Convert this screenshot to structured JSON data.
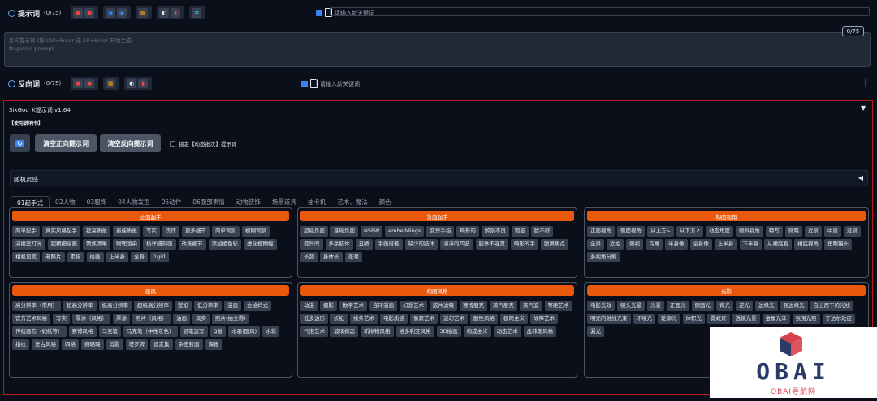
{
  "prompt": {
    "title": "提示词",
    "count": "(0/75)",
    "kw_placeholder": "请输入新关键词"
  },
  "negative": {
    "hint": "反向提示词 (按 Ctrl+Enter 或 Alt+Enter 开始生成)",
    "placeholder": "Negative prompt",
    "badge": "0/75",
    "title": "反向词",
    "count": "(0/75)",
    "kw_placeholder": "请输入新关键词"
  },
  "panel": {
    "title": "SixGod_K提示词 v1.64",
    "note": "【使用说明书】",
    "btn_clear_pos": "清空正向提示词",
    "btn_clear_neg": "清空反向提示词",
    "lock_label": "锁定【动态批次】提示词",
    "random": "随机灵感",
    "collapse": "▼",
    "expand": "◀"
  },
  "tabs": [
    "01起手式",
    "02人物",
    "03服饰",
    "04人物发型",
    "05动作",
    "06面部表情",
    "动物装饰",
    "场景道具",
    "抽卡机",
    "艺术、魔法",
    "颜色"
  ],
  "cards": [
    {
      "title": "正面起手",
      "tags": [
        "简单起手",
        "真实风格起手",
        "提高质量",
        "最佳质量",
        "写实",
        "杰作",
        "更多细节",
        "简单背景",
        "模糊背景",
        "演播室灯光",
        "超精细绘画",
        "聚焦清晰",
        "物理渲染",
        "极详细刻画",
        "改善细节",
        "添加绝色彩",
        "虚化模糊幅",
        "相机设置",
        "老照片",
        "素描",
        "绘画",
        "上半身",
        "全身",
        "1girl"
      ]
    },
    {
      "title": "负面起手",
      "tags": [
        "超级负面",
        "基础负面",
        "NSFW",
        "embeddings",
        "变异手指",
        "畸形的",
        "解剖不良",
        "瑕疵",
        "脸不好",
        "变异的",
        "多余肢体",
        "丑陋",
        "手画得差",
        "缺少的肢体",
        "漂浮的四肢",
        "肢体不连贯",
        "畸形的手",
        "脱离焦点",
        "长颈",
        "身体长",
        "涨潮"
      ]
    },
    {
      "title": "构图视角",
      "tags": [
        "正面视角",
        "侧面视角",
        "从上方↘",
        "从下方↗",
        "动态角度",
        "倾斜视角",
        "特写",
        "微距",
        "近景",
        "中景",
        "远景",
        "全景",
        "近拍",
        "俯视",
        "鸟瞰",
        "半身像",
        "全身像",
        "上半身",
        "下半身",
        "从裙底看",
        "裙底视角",
        "鱼眼镜头",
        "多视角分解"
      ]
    },
    {
      "title": "画风",
      "tags": [
        "高分辨率（常用）",
        "超高分辨率",
        "极高分辨率",
        "超级高分辨率",
        "壁纸",
        "低分辨率",
        "漫画",
        "立绘样式",
        "官方艺术风格",
        "写实",
        "厚涂（风格）",
        "厚涂",
        "照片（风格）",
        "油画",
        "真实",
        "照片(拍立得)",
        "传统画布（如纸等）",
        "赛博风格",
        "马克笔",
        "马克笔（中性灰色）",
        "铅笔速写",
        "Q版",
        "水墨(国风)",
        "水彩",
        "指纹",
        "复古风格",
        "四格",
        "赛璐璐",
        "剪影",
        "塔罗牌",
        "设定集",
        "杂志封面",
        "海报"
      ]
    },
    {
      "title": "构图风格",
      "tags": [
        "动漫",
        "摄影",
        "数字艺术",
        "连环漫画",
        "幻想艺术",
        "胶片滤镜",
        "赛博朋克",
        "蒸汽朋克",
        "蒸汽波",
        "等距艺术",
        "低多边形",
        "折纸",
        "线条艺术",
        "电影质感",
        "像素艺术",
        "迷幻艺术",
        "酸性风格",
        "极简主义",
        "故障艺术",
        "气泡艺术",
        "玻璃拟态",
        "新拟物风格",
        "维多利亚风格",
        "3D插画",
        "构成主义",
        "动态艺术",
        "孟菲斯风格"
      ]
    },
    {
      "title": "光影",
      "tags": [
        "电影光效",
        "镜头光晕",
        "光晕",
        "正面光",
        "侧面光",
        "背光",
        "逆光",
        "边缘光",
        "强边缘光",
        "自上而下的光线",
        "明亮的射线光束",
        "环境光",
        "轮廓光",
        "体积光",
        "霓虹灯",
        "透镜光晕",
        "金属光泽",
        "氛围光照",
        "丁达尔效应",
        "漏光"
      ]
    }
  ],
  "logo": {
    "text": "OBAI",
    "sub": "OBAI导航网"
  }
}
